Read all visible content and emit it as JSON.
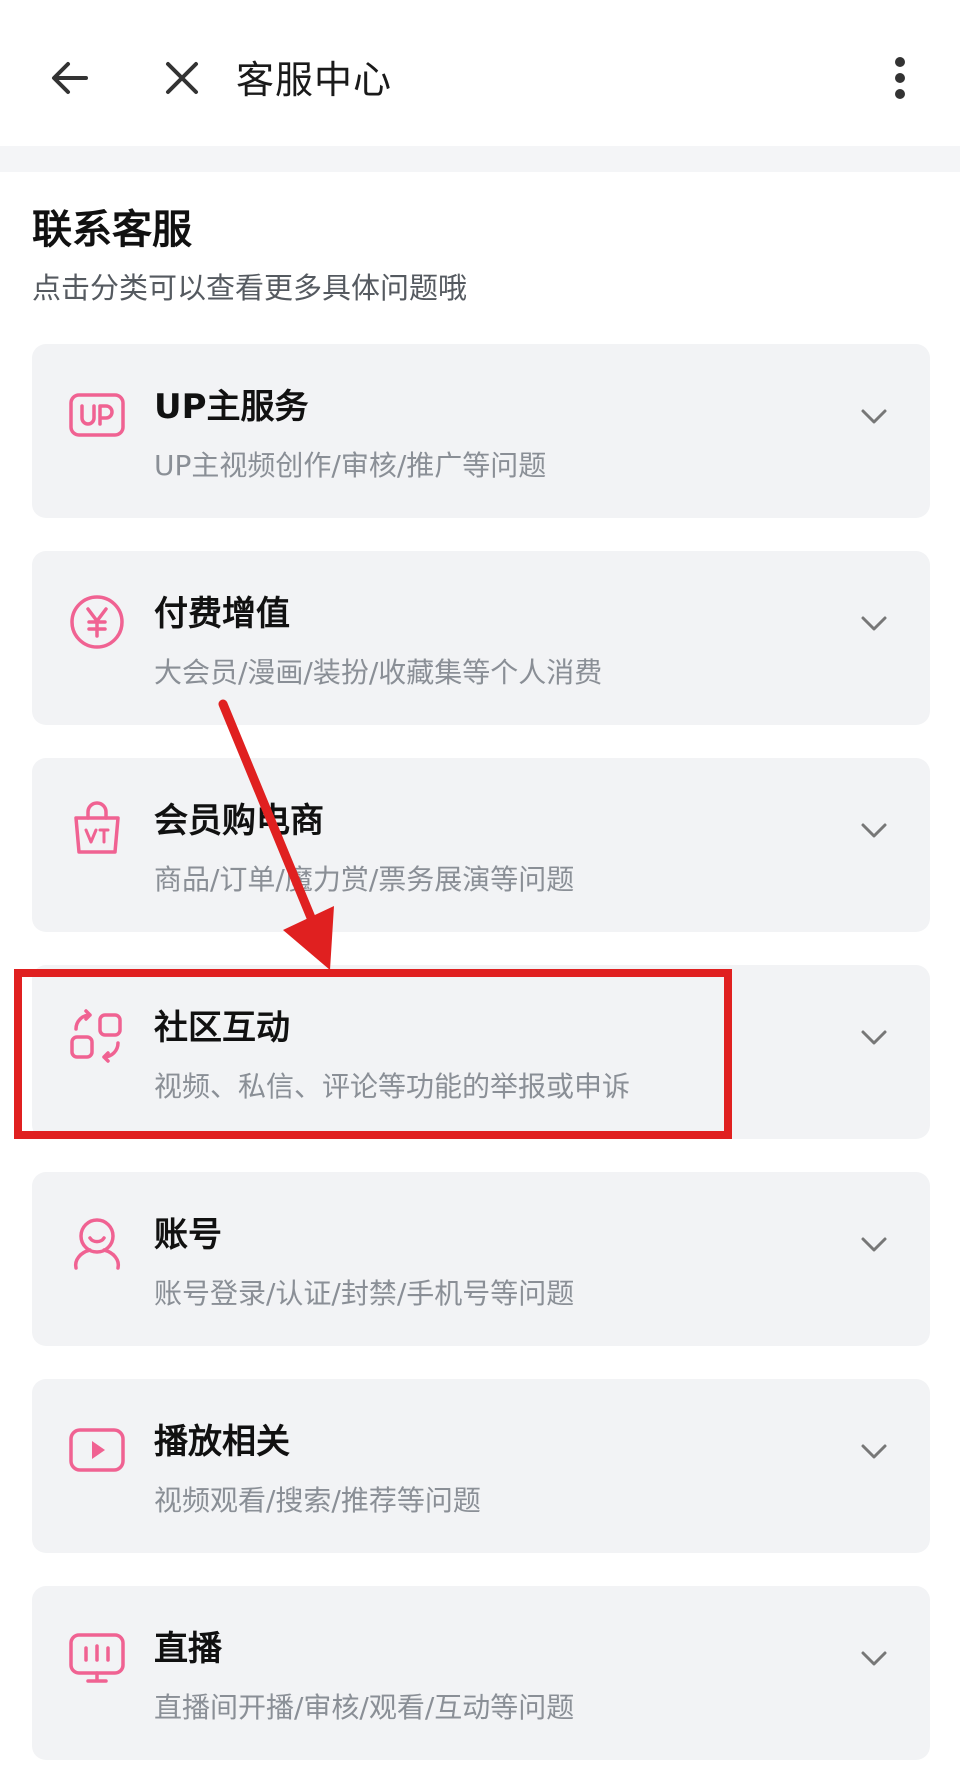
{
  "header": {
    "title": "客服中心",
    "back_icon": "arrow-left-icon",
    "close_icon": "close-icon",
    "more_icon": "more-vertical-icon"
  },
  "section": {
    "title": "联系客服",
    "subtitle": "点击分类可以查看更多具体问题哦"
  },
  "categories": [
    {
      "label": "UP主服务",
      "desc": "UP主视频创作/审核/推广等问题",
      "icon": "up-badge-icon"
    },
    {
      "label": "付费增值",
      "desc": "大会员/漫画/装扮/收藏集等个人消费",
      "icon": "yen-icon"
    },
    {
      "label": "会员购电商",
      "desc": "商品/订单/魔力赏/票务展演等问题",
      "icon": "shopping-bag-icon"
    },
    {
      "label": "社区互动",
      "desc": "视频、私信、评论等功能的举报或申诉",
      "icon": "community-icon"
    },
    {
      "label": "账号",
      "desc": "账号登录/认证/封禁/手机号等问题",
      "icon": "user-icon"
    },
    {
      "label": "播放相关",
      "desc": "视频观看/搜索/推荐等问题",
      "icon": "play-icon"
    },
    {
      "label": "直播",
      "desc": "直播间开播/审核/观看/互动等问题",
      "icon": "live-tv-icon"
    }
  ],
  "colors": {
    "accent_pink": "#f06292",
    "annotation_red": "#e02020",
    "card_bg": "#f2f3f5"
  }
}
